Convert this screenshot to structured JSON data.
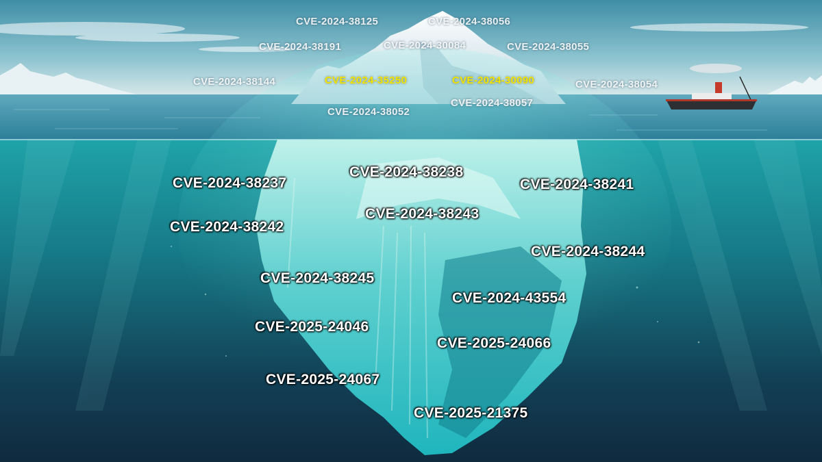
{
  "colors": {
    "sky_top": "#3f8ea6",
    "sky_horizon": "#d7e8ea",
    "sea_surface": "#3b93ab",
    "underwater_top": "#1fa3a8",
    "underwater_bottom": "#102a3e",
    "highlight_label": "#f2e400"
  },
  "cves_above_water": [
    {
      "id": "CVE-2024-38125",
      "highlight": false
    },
    {
      "id": "CVE-2024-38056",
      "highlight": false
    },
    {
      "id": "CVE-2024-38191",
      "highlight": false
    },
    {
      "id": "CVE-2024-30084",
      "highlight": false
    },
    {
      "id": "CVE-2024-38055",
      "highlight": false
    },
    {
      "id": "CVE-2024-38144",
      "highlight": false
    },
    {
      "id": "CVE-2024-35250",
      "highlight": true
    },
    {
      "id": "CVE-2024-30090",
      "highlight": true
    },
    {
      "id": "CVE-2024-38054",
      "highlight": false
    },
    {
      "id": "CVE-2024-38052",
      "highlight": false
    },
    {
      "id": "CVE-2024-38057",
      "highlight": false
    }
  ],
  "cves_below_water": [
    {
      "id": "CVE-2024-38237"
    },
    {
      "id": "CVE-2024-38238"
    },
    {
      "id": "CVE-2024-38241"
    },
    {
      "id": "CVE-2024-38243"
    },
    {
      "id": "CVE-2024-38242"
    },
    {
      "id": "CVE-2024-38244"
    },
    {
      "id": "CVE-2024-38245"
    },
    {
      "id": "CVE-2024-43554"
    },
    {
      "id": "CVE-2025-24046"
    },
    {
      "id": "CVE-2025-24066"
    },
    {
      "id": "CVE-2025-24067"
    },
    {
      "id": "CVE-2025-21375"
    }
  ]
}
